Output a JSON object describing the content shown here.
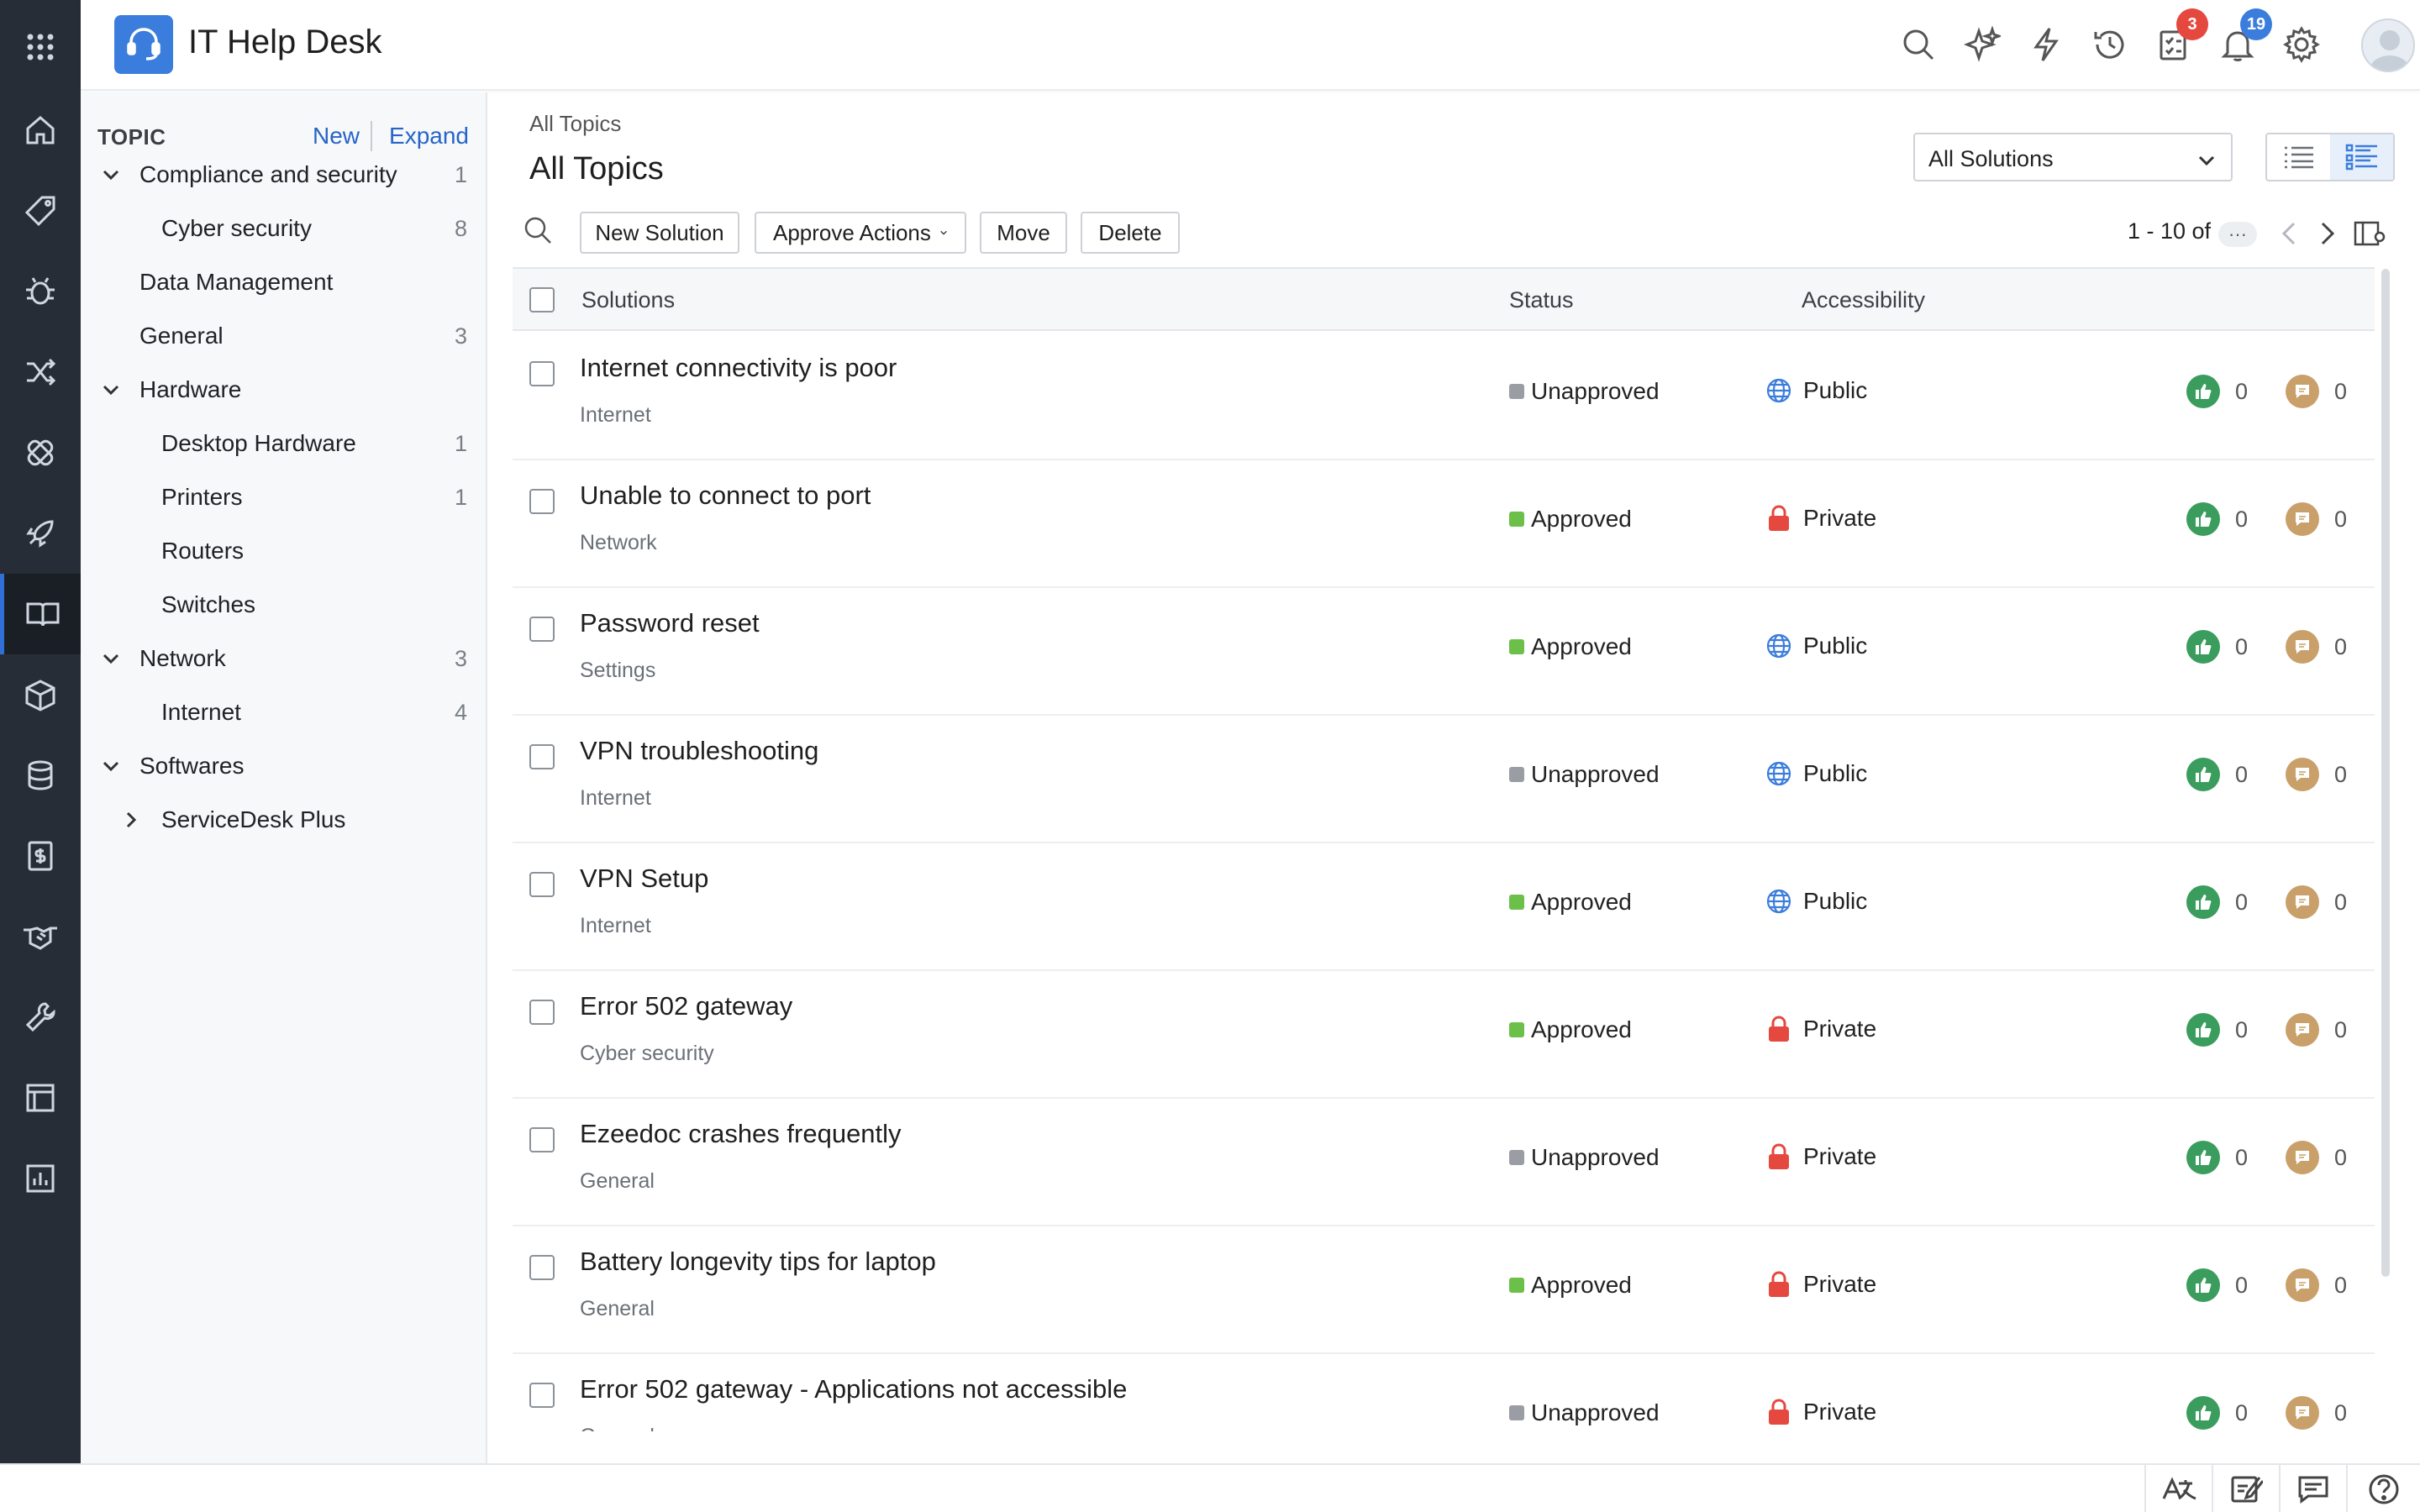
{
  "app": {
    "title": "IT Help Desk"
  },
  "header": {
    "icons": [
      "search-icon",
      "ai-sparkle-icon",
      "lightning-icon",
      "history-icon",
      "tasks-icon",
      "notifications-icon",
      "settings-icon",
      "avatar"
    ],
    "tasks_badge": "3",
    "notifications_badge": "19",
    "colors": {
      "tasks_badge": "#e5483f",
      "notifications_badge": "#3b7ddd"
    }
  },
  "rail": {
    "items": [
      "home-icon",
      "tag-icon",
      "bug-icon",
      "shuffle-icon",
      "bandage-icon",
      "rocket-icon",
      "book-icon",
      "box-icon",
      "database-icon",
      "invoice-icon",
      "handshake-icon",
      "wrench-icon",
      "layout-icon",
      "report-icon"
    ],
    "active": "book-icon"
  },
  "topics": {
    "label": "TOPIC",
    "new_label": "New",
    "expand_label": "Expand",
    "tree": [
      {
        "name": "Compliance and security",
        "count": "1",
        "chevron": "down",
        "level": 0
      },
      {
        "name": "Cyber security",
        "count": "8",
        "chevron": "",
        "level": 1
      },
      {
        "name": "Data Management",
        "count": "",
        "chevron": "",
        "level": 0
      },
      {
        "name": "General",
        "count": "3",
        "chevron": "",
        "level": 0
      },
      {
        "name": "Hardware",
        "count": "",
        "chevron": "down",
        "level": 0
      },
      {
        "name": "Desktop Hardware",
        "count": "1",
        "chevron": "",
        "level": 1
      },
      {
        "name": "Printers",
        "count": "1",
        "chevron": "",
        "level": 1
      },
      {
        "name": "Routers",
        "count": "",
        "chevron": "",
        "level": 1
      },
      {
        "name": "Switches",
        "count": "",
        "chevron": "",
        "level": 1
      },
      {
        "name": "Network",
        "count": "3",
        "chevron": "down",
        "level": 0
      },
      {
        "name": "Internet",
        "count": "4",
        "chevron": "",
        "level": 1
      },
      {
        "name": "Softwares",
        "count": "",
        "chevron": "down",
        "level": 0
      },
      {
        "name": "ServiceDesk Plus",
        "count": "",
        "chevron": "right",
        "level": 1
      }
    ]
  },
  "main": {
    "breadcrumb": "All Topics",
    "title": "All Topics",
    "filter_select": "All Solutions",
    "toolbar": {
      "new_solution": "New Solution",
      "approve_actions": "Approve Actions",
      "move": "Move",
      "delete": "Delete"
    },
    "pager": {
      "range": "1 - 10 of",
      "more": "···"
    },
    "columns": {
      "solutions": "Solutions",
      "status": "Status",
      "accessibility": "Accessibility"
    },
    "rows": [
      {
        "title": "Internet connectivity is poor",
        "topic": "Internet",
        "status": "Unapproved",
        "access": "Public",
        "likes": "0",
        "comments": "0"
      },
      {
        "title": "Unable to connect to port",
        "topic": "Network",
        "status": "Approved",
        "access": "Private",
        "likes": "0",
        "comments": "0"
      },
      {
        "title": "Password reset",
        "topic": "Settings",
        "status": "Approved",
        "access": "Public",
        "likes": "0",
        "comments": "0"
      },
      {
        "title": "VPN troubleshooting",
        "topic": "Internet",
        "status": "Unapproved",
        "access": "Public",
        "likes": "0",
        "comments": "0"
      },
      {
        "title": "VPN Setup",
        "topic": "Internet",
        "status": "Approved",
        "access": "Public",
        "likes": "0",
        "comments": "0"
      },
      {
        "title": "Error 502 gateway",
        "topic": "Cyber security",
        "status": "Approved",
        "access": "Private",
        "likes": "0",
        "comments": "0"
      },
      {
        "title": "Ezeedoc crashes frequently",
        "topic": "General",
        "status": "Unapproved",
        "access": "Private",
        "likes": "0",
        "comments": "0"
      },
      {
        "title": "Battery longevity tips for laptop",
        "topic": "General",
        "status": "Approved",
        "access": "Private",
        "likes": "0",
        "comments": "0"
      },
      {
        "title": "Error 502 gateway - Applications not accessible",
        "topic": "General",
        "status": "Unapproved",
        "access": "Private",
        "likes": "0",
        "comments": "0"
      }
    ],
    "status_colors": {
      "Approved": "#6cc04a",
      "Unapproved": "#9a9ea4"
    },
    "access_colors": {
      "Public": "#3b7ddd",
      "Private": "#e5483f"
    },
    "like_color": "#3a9d5d",
    "comment_color": "#c9a06a"
  },
  "footer": {
    "icons": [
      "translate-icon",
      "notes-icon",
      "chat-icon",
      "help-icon"
    ]
  }
}
